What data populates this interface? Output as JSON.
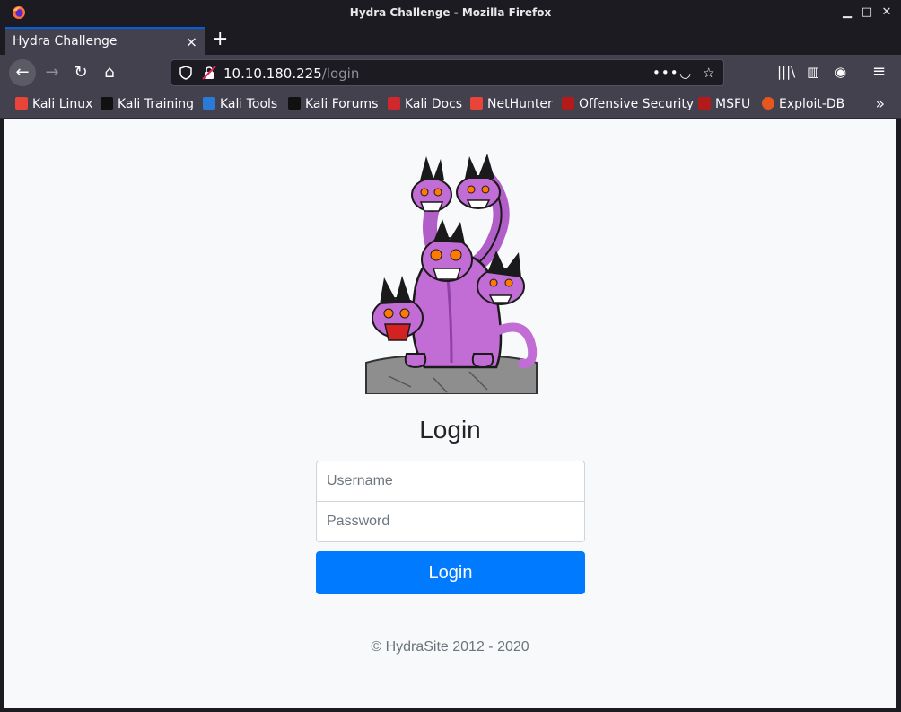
{
  "window": {
    "title": "Hydra Challenge - Mozilla Firefox",
    "minimize_glyph": "▁",
    "maximize_glyph": "□",
    "close_glyph": "✕"
  },
  "tabs": [
    {
      "label": "Hydra Challenge",
      "active": true
    }
  ],
  "tab_close_glyph": "×",
  "new_tab_glyph": "+",
  "nav": {
    "back_glyph": "←",
    "forward_glyph": "→",
    "reload_glyph": "↻",
    "home_glyph": "⌂"
  },
  "urlbar": {
    "host": "10.10.180.225",
    "path": "/login",
    "more_glyph": "•••",
    "pocket_glyph": "◡",
    "star_glyph": "☆"
  },
  "toolbar": {
    "library_glyph": "|||\\",
    "sidebar_glyph": "▥",
    "account_glyph": "◉",
    "menu_glyph": "≡"
  },
  "bookmarks": [
    {
      "label": "Kali Linux",
      "icon": "kali-dragon-icon",
      "color": "#e8443a"
    },
    {
      "label": "Kali Training",
      "icon": "kali-training-icon",
      "color": "#111111"
    },
    {
      "label": "Kali Tools",
      "icon": "kali-tools-icon",
      "color": "#2a7bd6"
    },
    {
      "label": "Kali Forums",
      "icon": "kali-forums-icon",
      "color": "#111111"
    },
    {
      "label": "Kali Docs",
      "icon": "kali-docs-icon",
      "color": "#d0282d"
    },
    {
      "label": "NetHunter",
      "icon": "nethunter-icon",
      "color": "#e8443a"
    },
    {
      "label": "Offensive Security",
      "icon": "offsec-icon",
      "color": "#b31b1b"
    },
    {
      "label": "MSFU",
      "icon": "msfu-icon",
      "color": "#b31b1b"
    },
    {
      "label": "Exploit-DB",
      "icon": "exploit-db-icon",
      "color": "#e8561f"
    }
  ],
  "bookmarks_overflow_glyph": "»",
  "page": {
    "heading": "Login",
    "username_placeholder": "Username",
    "password_placeholder": "Password",
    "button_label": "Login",
    "footer": "© HydraSite 2012 - 2020",
    "accent_color": "#007bff"
  }
}
